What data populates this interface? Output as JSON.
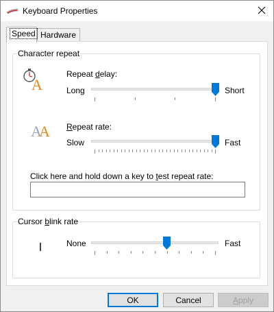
{
  "window": {
    "title": "Keyboard Properties",
    "icon": "keyboard-icon"
  },
  "tabs": [
    {
      "label": "Speed",
      "active": true
    },
    {
      "label": "Hardware",
      "active": false
    }
  ],
  "character_repeat": {
    "group_label": "Character repeat",
    "repeat_delay": {
      "label_pre": "Repeat ",
      "label_accel": "d",
      "label_post": "elay:",
      "min_label": "Long",
      "max_label": "Short",
      "value": 1.0
    },
    "repeat_rate": {
      "label_pre": "",
      "label_accel": "R",
      "label_post": "epeat rate:",
      "min_label": "Slow",
      "max_label": "Fast",
      "value": 1.0
    },
    "test_prompt_pre": "Click here and hold down a key to ",
    "test_prompt_accel": "t",
    "test_prompt_post": "est repeat rate:",
    "test_value": ""
  },
  "cursor_blink": {
    "group_label_pre": "Cursor ",
    "group_label_accel": "b",
    "group_label_post": "link rate",
    "min_label": "None",
    "max_label": "Fast",
    "value": 0.6
  },
  "buttons": {
    "ok": "OK",
    "cancel": "Cancel",
    "apply_accel": "A",
    "apply_post": "pply"
  },
  "colors": {
    "accent": "#0078d7",
    "icon_orange": "#e8861a",
    "icon_gray": "#9aa6b4"
  }
}
